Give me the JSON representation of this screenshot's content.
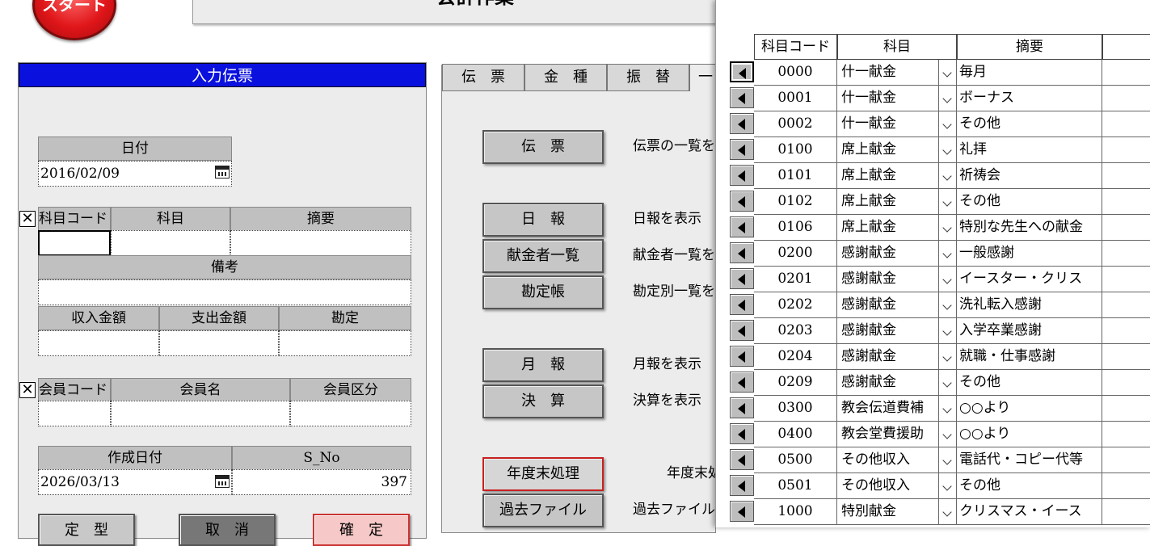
{
  "app": {
    "start_label": "スタート",
    "title": "会計作業"
  },
  "entry_panel": {
    "header": "入力伝票",
    "date_label": "日付",
    "date_value": "2016/02/09",
    "account": {
      "col_code": "科目コード",
      "col_subject": "科目",
      "col_summary": "摘要",
      "code_value": "",
      "subject_value": "",
      "summary_value": ""
    },
    "remarks_label": "備考",
    "remarks_value": "",
    "amounts": {
      "income_label": "収入金額",
      "expense_label": "支出金額",
      "account_label": "勘定",
      "income_value": "",
      "expense_value": "",
      "account_value": ""
    },
    "member": {
      "col_code": "会員コード",
      "col_name": "会員名",
      "col_type": "会員区分",
      "code_value": "",
      "name_value": "",
      "type_value": ""
    },
    "created_label": "作成日付",
    "sno_label": "S_No",
    "created_value": "2026/03/13",
    "sno_value": "397",
    "buttons": [
      "定　型",
      "取　消",
      "確　定"
    ]
  },
  "menu_panel": {
    "tabs": [
      "伝　票",
      "金　種",
      "振　替",
      "一"
    ],
    "items": [
      {
        "button": "伝　票",
        "desc": "伝票の一覧を"
      },
      {
        "button": "日　報",
        "desc": "日報を表示"
      },
      {
        "button": "献金者一覧",
        "desc": "献金者一覧を"
      },
      {
        "button": "勘定帳",
        "desc": "勘定別一覧を"
      },
      {
        "button": "月　報",
        "desc": "月報を表示"
      },
      {
        "button": "決　算",
        "desc": "決算を表示"
      },
      {
        "button": "年度末処理",
        "desc": "年度末処"
      },
      {
        "button": "過去ファイル",
        "desc": "過去ファイル"
      }
    ]
  },
  "account_list": {
    "headers": {
      "code": "科目コード",
      "subject": "科目",
      "summary": "摘要",
      "extra": ""
    },
    "rows": [
      {
        "code": "0000",
        "subject": "什一献金",
        "summary": "毎月"
      },
      {
        "code": "0001",
        "subject": "什一献金",
        "summary": "ボーナス"
      },
      {
        "code": "0002",
        "subject": "什一献金",
        "summary": "その他"
      },
      {
        "code": "0100",
        "subject": "席上献金",
        "summary": "礼拝"
      },
      {
        "code": "0101",
        "subject": "席上献金",
        "summary": "祈祷会"
      },
      {
        "code": "0102",
        "subject": "席上献金",
        "summary": "その他"
      },
      {
        "code": "0106",
        "subject": "席上献金",
        "summary": "特別な先生への献金"
      },
      {
        "code": "0200",
        "subject": "感謝献金",
        "summary": "一般感謝"
      },
      {
        "code": "0201",
        "subject": "感謝献金",
        "summary": "イースター・クリス"
      },
      {
        "code": "0202",
        "subject": "感謝献金",
        "summary": "洗礼転入感謝"
      },
      {
        "code": "0203",
        "subject": "感謝献金",
        "summary": "入学卒業感謝"
      },
      {
        "code": "0204",
        "subject": "感謝献金",
        "summary": "就職・仕事感謝"
      },
      {
        "code": "0209",
        "subject": "感謝献金",
        "summary": "その他"
      },
      {
        "code": "0300",
        "subject": "教会伝道費補",
        "summary": "○○より"
      },
      {
        "code": "0400",
        "subject": "教会堂費援助",
        "summary": "○○より"
      },
      {
        "code": "0500",
        "subject": "その他収入",
        "summary": "電話代・コピー代等"
      },
      {
        "code": "0501",
        "subject": "その他収入",
        "summary": "その他"
      },
      {
        "code": "1000",
        "subject": "特別献金",
        "summary": "クリスマス・イース"
      }
    ]
  }
}
